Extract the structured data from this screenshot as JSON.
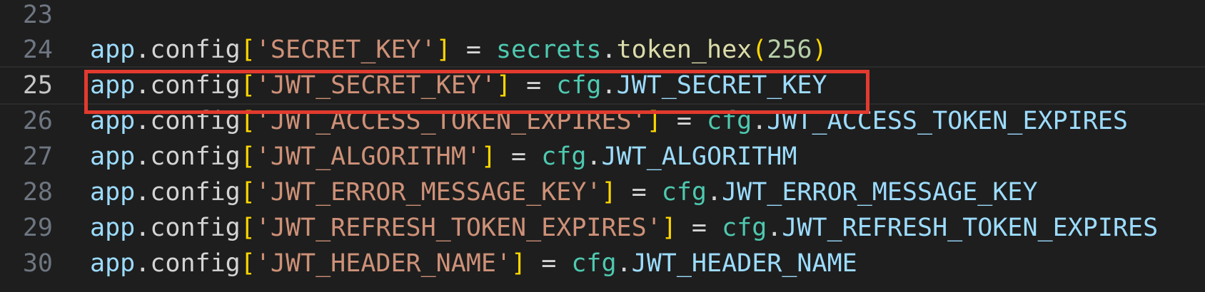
{
  "editor": {
    "lines": [
      {
        "number": "23",
        "tokens": []
      },
      {
        "number": "24",
        "tokens": [
          {
            "t": "app",
            "k": "var"
          },
          {
            "t": ".",
            "k": "punc"
          },
          {
            "t": "config",
            "k": "prop"
          },
          {
            "t": "[",
            "k": "brk"
          },
          {
            "t": "'SECRET_KEY'",
            "k": "str"
          },
          {
            "t": "]",
            "k": "brk"
          },
          {
            "t": " = ",
            "k": "op"
          },
          {
            "t": "secrets",
            "k": "mod"
          },
          {
            "t": ".",
            "k": "punc"
          },
          {
            "t": "token_hex",
            "k": "fn"
          },
          {
            "t": "(",
            "k": "brk"
          },
          {
            "t": "256",
            "k": "num"
          },
          {
            "t": ")",
            "k": "brk"
          }
        ]
      },
      {
        "number": "25",
        "active": true,
        "tokens": [
          {
            "t": "app",
            "k": "var"
          },
          {
            "t": ".",
            "k": "punc"
          },
          {
            "t": "config",
            "k": "prop"
          },
          {
            "t": "[",
            "k": "brk"
          },
          {
            "t": "'JWT_SECRET_KEY'",
            "k": "str"
          },
          {
            "t": "]",
            "k": "brk"
          },
          {
            "t": " = ",
            "k": "op"
          },
          {
            "t": "cfg",
            "k": "mod"
          },
          {
            "t": ".",
            "k": "punc"
          },
          {
            "t": "JWT_SECRET_KEY",
            "k": "const"
          }
        ]
      },
      {
        "number": "26",
        "tokens": [
          {
            "t": "app",
            "k": "var"
          },
          {
            "t": ".",
            "k": "punc"
          },
          {
            "t": "config",
            "k": "prop"
          },
          {
            "t": "[",
            "k": "brk"
          },
          {
            "t": "'JWT_ACCESS_TOKEN_EXPIRES'",
            "k": "str"
          },
          {
            "t": "]",
            "k": "brk"
          },
          {
            "t": " = ",
            "k": "op"
          },
          {
            "t": "cfg",
            "k": "mod"
          },
          {
            "t": ".",
            "k": "punc"
          },
          {
            "t": "JWT_ACCESS_TOKEN_EXPIRES",
            "k": "const"
          }
        ]
      },
      {
        "number": "27",
        "tokens": [
          {
            "t": "app",
            "k": "var"
          },
          {
            "t": ".",
            "k": "punc"
          },
          {
            "t": "config",
            "k": "prop"
          },
          {
            "t": "[",
            "k": "brk"
          },
          {
            "t": "'JWT_ALGORITHM'",
            "k": "str"
          },
          {
            "t": "]",
            "k": "brk"
          },
          {
            "t": " = ",
            "k": "op"
          },
          {
            "t": "cfg",
            "k": "mod"
          },
          {
            "t": ".",
            "k": "punc"
          },
          {
            "t": "JWT_ALGORITHM",
            "k": "const"
          }
        ]
      },
      {
        "number": "28",
        "tokens": [
          {
            "t": "app",
            "k": "var"
          },
          {
            "t": ".",
            "k": "punc"
          },
          {
            "t": "config",
            "k": "prop"
          },
          {
            "t": "[",
            "k": "brk"
          },
          {
            "t": "'JWT_ERROR_MESSAGE_KEY'",
            "k": "str"
          },
          {
            "t": "]",
            "k": "brk"
          },
          {
            "t": " = ",
            "k": "op"
          },
          {
            "t": "cfg",
            "k": "mod"
          },
          {
            "t": ".",
            "k": "punc"
          },
          {
            "t": "JWT_ERROR_MESSAGE_KEY",
            "k": "const"
          }
        ]
      },
      {
        "number": "29",
        "tokens": [
          {
            "t": "app",
            "k": "var"
          },
          {
            "t": ".",
            "k": "punc"
          },
          {
            "t": "config",
            "k": "prop"
          },
          {
            "t": "[",
            "k": "brk"
          },
          {
            "t": "'JWT_REFRESH_TOKEN_EXPIRES'",
            "k": "str"
          },
          {
            "t": "]",
            "k": "brk"
          },
          {
            "t": " = ",
            "k": "op"
          },
          {
            "t": "cfg",
            "k": "mod"
          },
          {
            "t": ".",
            "k": "punc"
          },
          {
            "t": "JWT_REFRESH_TOKEN_EXPIRES",
            "k": "const"
          }
        ]
      },
      {
        "number": "30",
        "tokens": [
          {
            "t": "app",
            "k": "var"
          },
          {
            "t": ".",
            "k": "punc"
          },
          {
            "t": "config",
            "k": "prop"
          },
          {
            "t": "[",
            "k": "brk"
          },
          {
            "t": "'JWT_HEADER_NAME'",
            "k": "str"
          },
          {
            "t": "]",
            "k": "brk"
          },
          {
            "t": " = ",
            "k": "op"
          },
          {
            "t": "cfg",
            "k": "mod"
          },
          {
            "t": ".",
            "k": "punc"
          },
          {
            "t": "JWT_HEADER_NAME",
            "k": "const"
          }
        ]
      }
    ]
  },
  "colors": {
    "background": "#1e1e1e",
    "highlight_border": "#e23a2e",
    "string": "#ce9178",
    "bracket": "#ffd700",
    "module": "#4ec9b0",
    "variable": "#9cdcfe"
  }
}
